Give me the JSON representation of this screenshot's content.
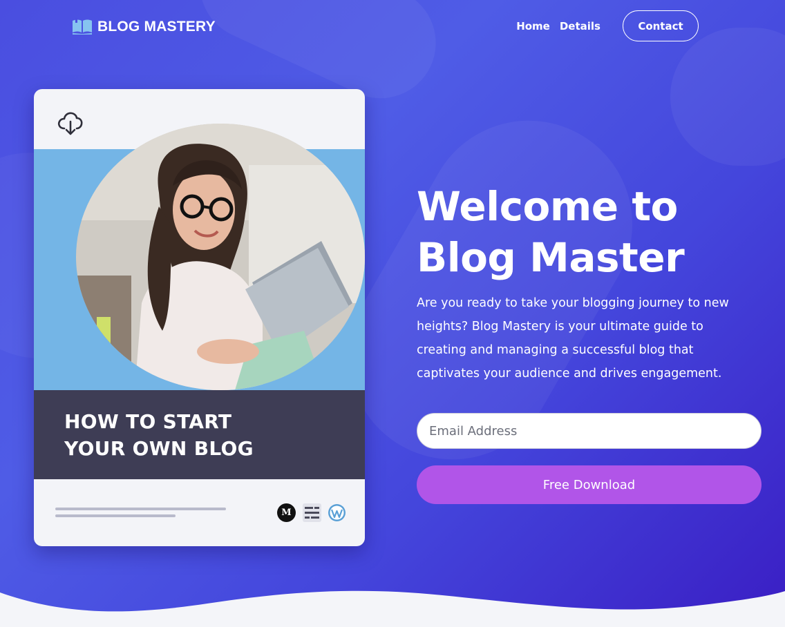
{
  "brand": {
    "name": "BLOG MASTERY",
    "icon": "open-book-icon"
  },
  "nav": {
    "items": [
      {
        "label": "Home"
      },
      {
        "label": "Details"
      }
    ],
    "contact_label": "Contact"
  },
  "book": {
    "top_icon": "cloud-download-icon",
    "title_line1": "HOW TO START",
    "title_line2": "YOUR OWN BLOG",
    "photo": "woman-with-glasses-typing-on-laptop",
    "platform_icons": [
      "medium-icon",
      "substack-icon",
      "wordpress-icon"
    ],
    "platform_m_letter": "M"
  },
  "hero": {
    "title_line1": "Welcome to",
    "title_line2": "Blog Master",
    "description": "Are you ready to take your blogging journey to new heights? Blog Mastery is your ultimate guide to creating and managing a successful blog that captivates your audience and drives engagement.",
    "email_placeholder": "Email Address",
    "email_value": "",
    "download_label": "Free Download"
  },
  "colors": {
    "background": "#4a4ee0",
    "button": "#b155e8",
    "book_band": "#74b5e6",
    "book_title_panel": "#3e3d55"
  }
}
